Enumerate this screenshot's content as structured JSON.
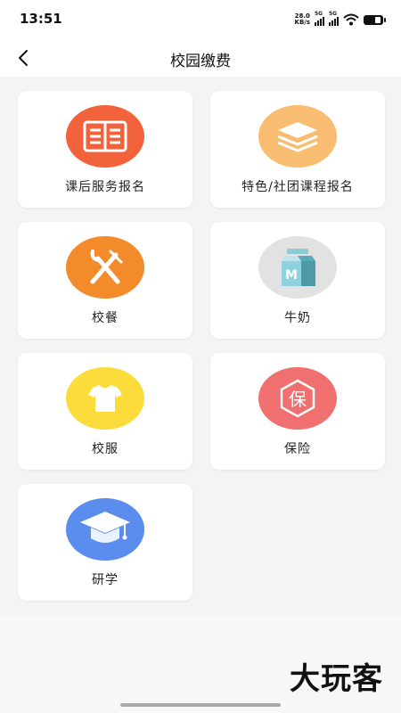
{
  "status_bar": {
    "time": "13:51",
    "net_speed_value": "28.0",
    "net_speed_unit": "KB/s",
    "signal1_label": "5G",
    "signal2_label": "5G"
  },
  "nav": {
    "title": "校园缴费",
    "back_icon": "chevron-left-icon"
  },
  "grid": {
    "items": [
      {
        "label": "课后服务报名",
        "icon": "book-icon",
        "color": "#f2633c"
      },
      {
        "label": "特色/社团课程报名",
        "icon": "layers-icon",
        "color": "#f9bd72"
      },
      {
        "label": "校餐",
        "icon": "fork-knife-icon",
        "color": "#f38b2a"
      },
      {
        "label": "牛奶",
        "icon": "milk-box-icon",
        "color": "#e2e2e2"
      },
      {
        "label": "校服",
        "icon": "tshirt-icon",
        "color": "#fbdc3b"
      },
      {
        "label": "保险",
        "icon": "insurance-badge-icon",
        "color": "#f07070"
      },
      {
        "label": "研学",
        "icon": "graduation-cap-icon",
        "color": "#5b8def"
      }
    ]
  },
  "watermark": "大玩客"
}
